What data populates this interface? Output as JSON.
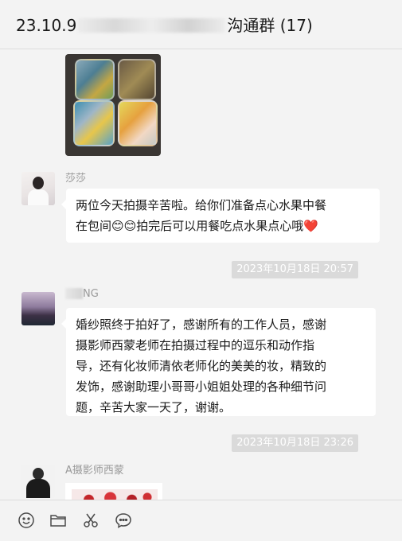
{
  "header": {
    "title_prefix": "23.10.9",
    "title_suffix": "沟通群 (17)"
  },
  "messages": [
    {
      "sender": "莎莎",
      "text": "两位今天拍摄辛苦啦。给你们准备点心水果中餐\n在包间😊😊拍完后可以用餐吃点水果点心哦❤️"
    },
    {
      "timestamp": "2023年10月18日 20:57"
    },
    {
      "sender": "NG",
      "text": "婚纱照终于拍好了，感谢所有的工作人员，感谢\n摄影师西蒙老师在拍摄过程中的逗乐和动作指\n导，还有化妆师清依老师化的美美的妆，精致的\n发饰，感谢助理小哥哥小姐姐处理的各种细节问\n题，辛苦大家一天了，谢谢。"
    },
    {
      "timestamp": "2023年10月18日 23:26"
    },
    {
      "sender": "A摄影师西蒙"
    }
  ],
  "toolbar": {
    "icons": [
      "emoji-icon",
      "folder-icon",
      "scissors-icon",
      "chat-icon"
    ]
  },
  "colors": {
    "background": "#f3f3f3",
    "bubble": "#ffffff",
    "timestamp_bg": "#dadada",
    "sender_name": "#9a9a9a"
  }
}
